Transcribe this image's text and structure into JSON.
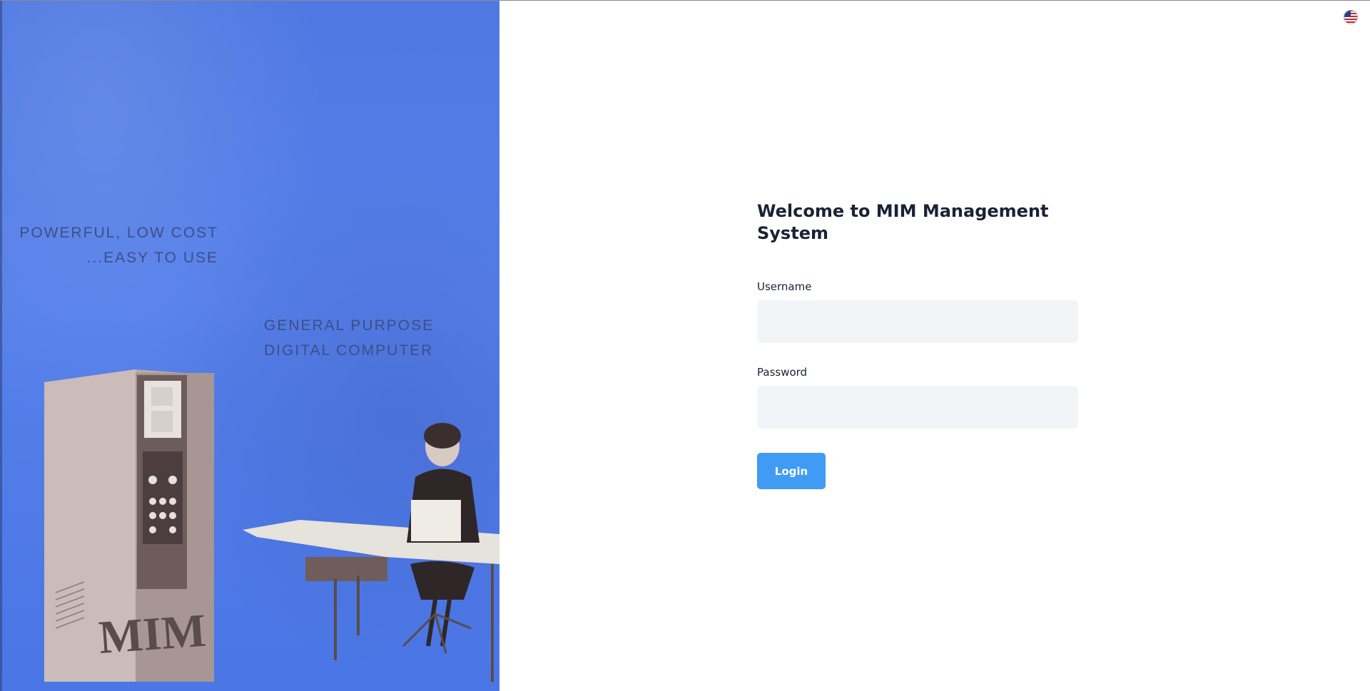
{
  "poster": {
    "tagline_line1": "POWERFUL, LOW COST",
    "tagline_line2": "...EASY TO USE",
    "subtitle_line1": "GENERAL PURPOSE",
    "subtitle_line2": "DIGITAL COMPUTER",
    "brand": "MIM"
  },
  "header": {
    "language_icon": "us-flag-icon"
  },
  "login": {
    "title": "Welcome to MIM Management System",
    "username_label": "Username",
    "username_value": "",
    "password_label": "Password",
    "password_value": "",
    "submit_label": "Login"
  },
  "colors": {
    "accent": "#3f9bf4",
    "poster_blue": "#5680ea",
    "title_text": "#1b2235",
    "input_bg": "#f2f4f7"
  }
}
